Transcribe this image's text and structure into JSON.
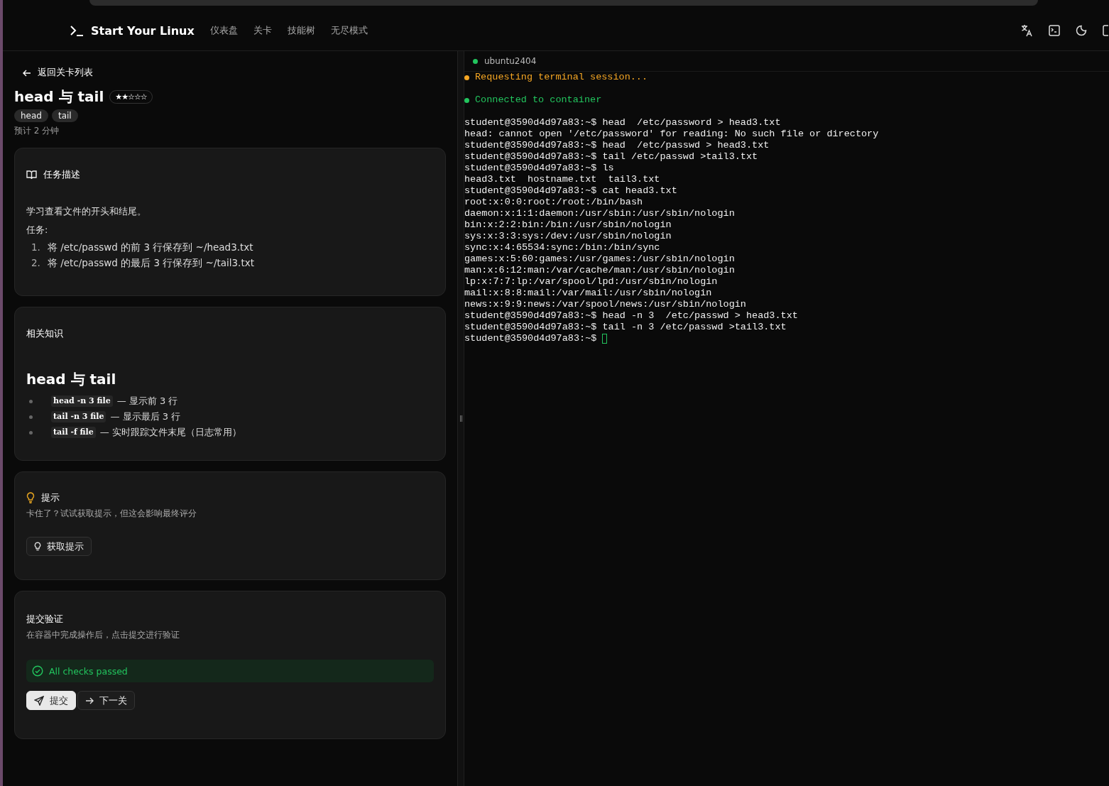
{
  "nav": {
    "brand": "Start Your Linux",
    "links": [
      {
        "label": "仪表盘"
      },
      {
        "label": "关卡"
      },
      {
        "label": "技能树"
      },
      {
        "label": "无尽模式"
      }
    ]
  },
  "back_link": "返回关卡列表",
  "level": {
    "title": "head 与 tail",
    "difficulty": "★★☆☆☆",
    "tags": [
      "head",
      "tail"
    ],
    "estimate": "预计 2 分钟"
  },
  "task": {
    "heading": "任务描述",
    "intro": "学习查看文件的开头和结尾。",
    "label": "任务:",
    "steps": [
      {
        "number": "1.",
        "text": "将 /etc/passwd 的前 3 行保存到 ~/head3.txt"
      },
      {
        "number": "2.",
        "text": "将 /etc/passwd 的最后 3 行保存到 ~/tail3.txt"
      }
    ]
  },
  "knowledge": {
    "heading": "相关知识",
    "title": "head 与 tail",
    "items": [
      {
        "code": "head -n 3 file",
        "text": "— 显示前 3 行"
      },
      {
        "code": "tail -n 3 file",
        "text": "— 显示最后 3 行"
      },
      {
        "code": "tail -f file",
        "text": "— 实时跟踪文件末尾（日志常用）"
      }
    ]
  },
  "hint": {
    "heading": "提示",
    "text": "卡住了？试试获取提示，但这会影响最终评分",
    "button": "获取提示"
  },
  "submit": {
    "heading": "提交验证",
    "text": "在容器中完成操作后，点击提交进行验证",
    "result": "All checks passed",
    "passed": true,
    "buttons": [
      {
        "label": "提交",
        "kind": "primary"
      },
      {
        "label": "下一关",
        "kind": "secondary"
      }
    ]
  },
  "terminal": {
    "host": "ubuntu2404",
    "cursor": true,
    "lines": [
      {
        "kind": "status",
        "text": "Requesting terminal session...",
        "color": "#f5a623"
      },
      {
        "kind": "blank"
      },
      {
        "kind": "status",
        "text": "Connected to container",
        "color": "#22c55e"
      },
      {
        "kind": "blank"
      },
      {
        "kind": "prompt",
        "prompt": "student@3590d4d97a83:~$",
        "command": "head  /etc/password > head3.txt"
      },
      {
        "kind": "output",
        "text": "head: cannot open '/etc/password' for reading: No such file or directory"
      },
      {
        "kind": "prompt",
        "prompt": "student@3590d4d97a83:~$",
        "command": "head  /etc/passwd > head3.txt"
      },
      {
        "kind": "prompt",
        "prompt": "student@3590d4d97a83:~$",
        "command": "tail /etc/passwd >tail3.txt"
      },
      {
        "kind": "prompt",
        "prompt": "student@3590d4d97a83:~$",
        "command": "ls"
      },
      {
        "kind": "output",
        "text": "head3.txt  hostname.txt  tail3.txt"
      },
      {
        "kind": "prompt",
        "prompt": "student@3590d4d97a83:~$",
        "command": "cat head3.txt"
      },
      {
        "kind": "output",
        "text": "root:x:0:0:root:/root:/bin/bash"
      },
      {
        "kind": "output",
        "text": "daemon:x:1:1:daemon:/usr/sbin:/usr/sbin/nologin"
      },
      {
        "kind": "output",
        "text": "bin:x:2:2:bin:/bin:/usr/sbin/nologin"
      },
      {
        "kind": "output",
        "text": "sys:x:3:3:sys:/dev:/usr/sbin/nologin"
      },
      {
        "kind": "output",
        "text": "sync:x:4:65534:sync:/bin:/bin/sync"
      },
      {
        "kind": "output",
        "text": "games:x:5:60:games:/usr/games:/usr/sbin/nologin"
      },
      {
        "kind": "output",
        "text": "man:x:6:12:man:/var/cache/man:/usr/sbin/nologin"
      },
      {
        "kind": "output",
        "text": "lp:x:7:7:lp:/var/spool/lpd:/usr/sbin/nologin"
      },
      {
        "kind": "output",
        "text": "mail:x:8:8:mail:/var/mail:/usr/sbin/nologin"
      },
      {
        "kind": "output",
        "text": "news:x:9:9:news:/var/spool/news:/usr/sbin/nologin"
      },
      {
        "kind": "prompt",
        "prompt": "student@3590d4d97a83:~$",
        "command": "head -n 3  /etc/passwd > head3.txt"
      },
      {
        "kind": "prompt",
        "prompt": "student@3590d4d97a83:~$",
        "command": "tail -n 3 /etc/passwd >tail3.txt"
      },
      {
        "kind": "prompt",
        "prompt": "student@3590d4d97a83:~$"
      }
    ]
  }
}
